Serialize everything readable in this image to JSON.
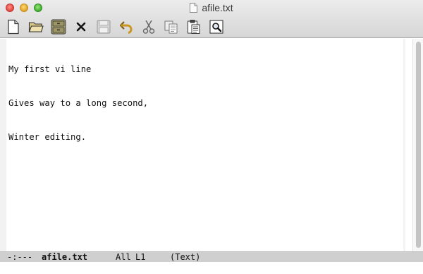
{
  "window": {
    "title": "afile.txt"
  },
  "toolbar": {
    "buttons": [
      {
        "name": "new-file",
        "icon": "new-document-icon"
      },
      {
        "name": "open-file",
        "icon": "folder-icon"
      },
      {
        "name": "dired",
        "icon": "file-cabinet-icon"
      },
      {
        "name": "kill-buffer",
        "icon": "close-x-icon"
      },
      {
        "name": "save",
        "icon": "floppy-disk-icon"
      },
      {
        "name": "undo",
        "icon": "undo-arrow-icon"
      },
      {
        "name": "cut",
        "icon": "scissors-icon"
      },
      {
        "name": "copy",
        "icon": "copy-icon"
      },
      {
        "name": "paste",
        "icon": "clipboard-icon"
      },
      {
        "name": "search",
        "icon": "search-icon"
      }
    ]
  },
  "buffer": {
    "lines": [
      "My first vi line",
      "Gives way to a long second,",
      "Winter editing."
    ]
  },
  "modeline": {
    "status": "-:---",
    "buffer_name": "afile.txt",
    "position": "All",
    "line": "L1",
    "mode": "(Text)"
  },
  "minibuffer": {
    "text": ""
  },
  "colors": {
    "titlebar_top": "#ececec",
    "titlebar_bottom": "#d6d6d6",
    "modeline_bg": "#cfcfcf",
    "close": "#e0443e",
    "minimize": "#e0a523",
    "maximize": "#3fae2c"
  }
}
